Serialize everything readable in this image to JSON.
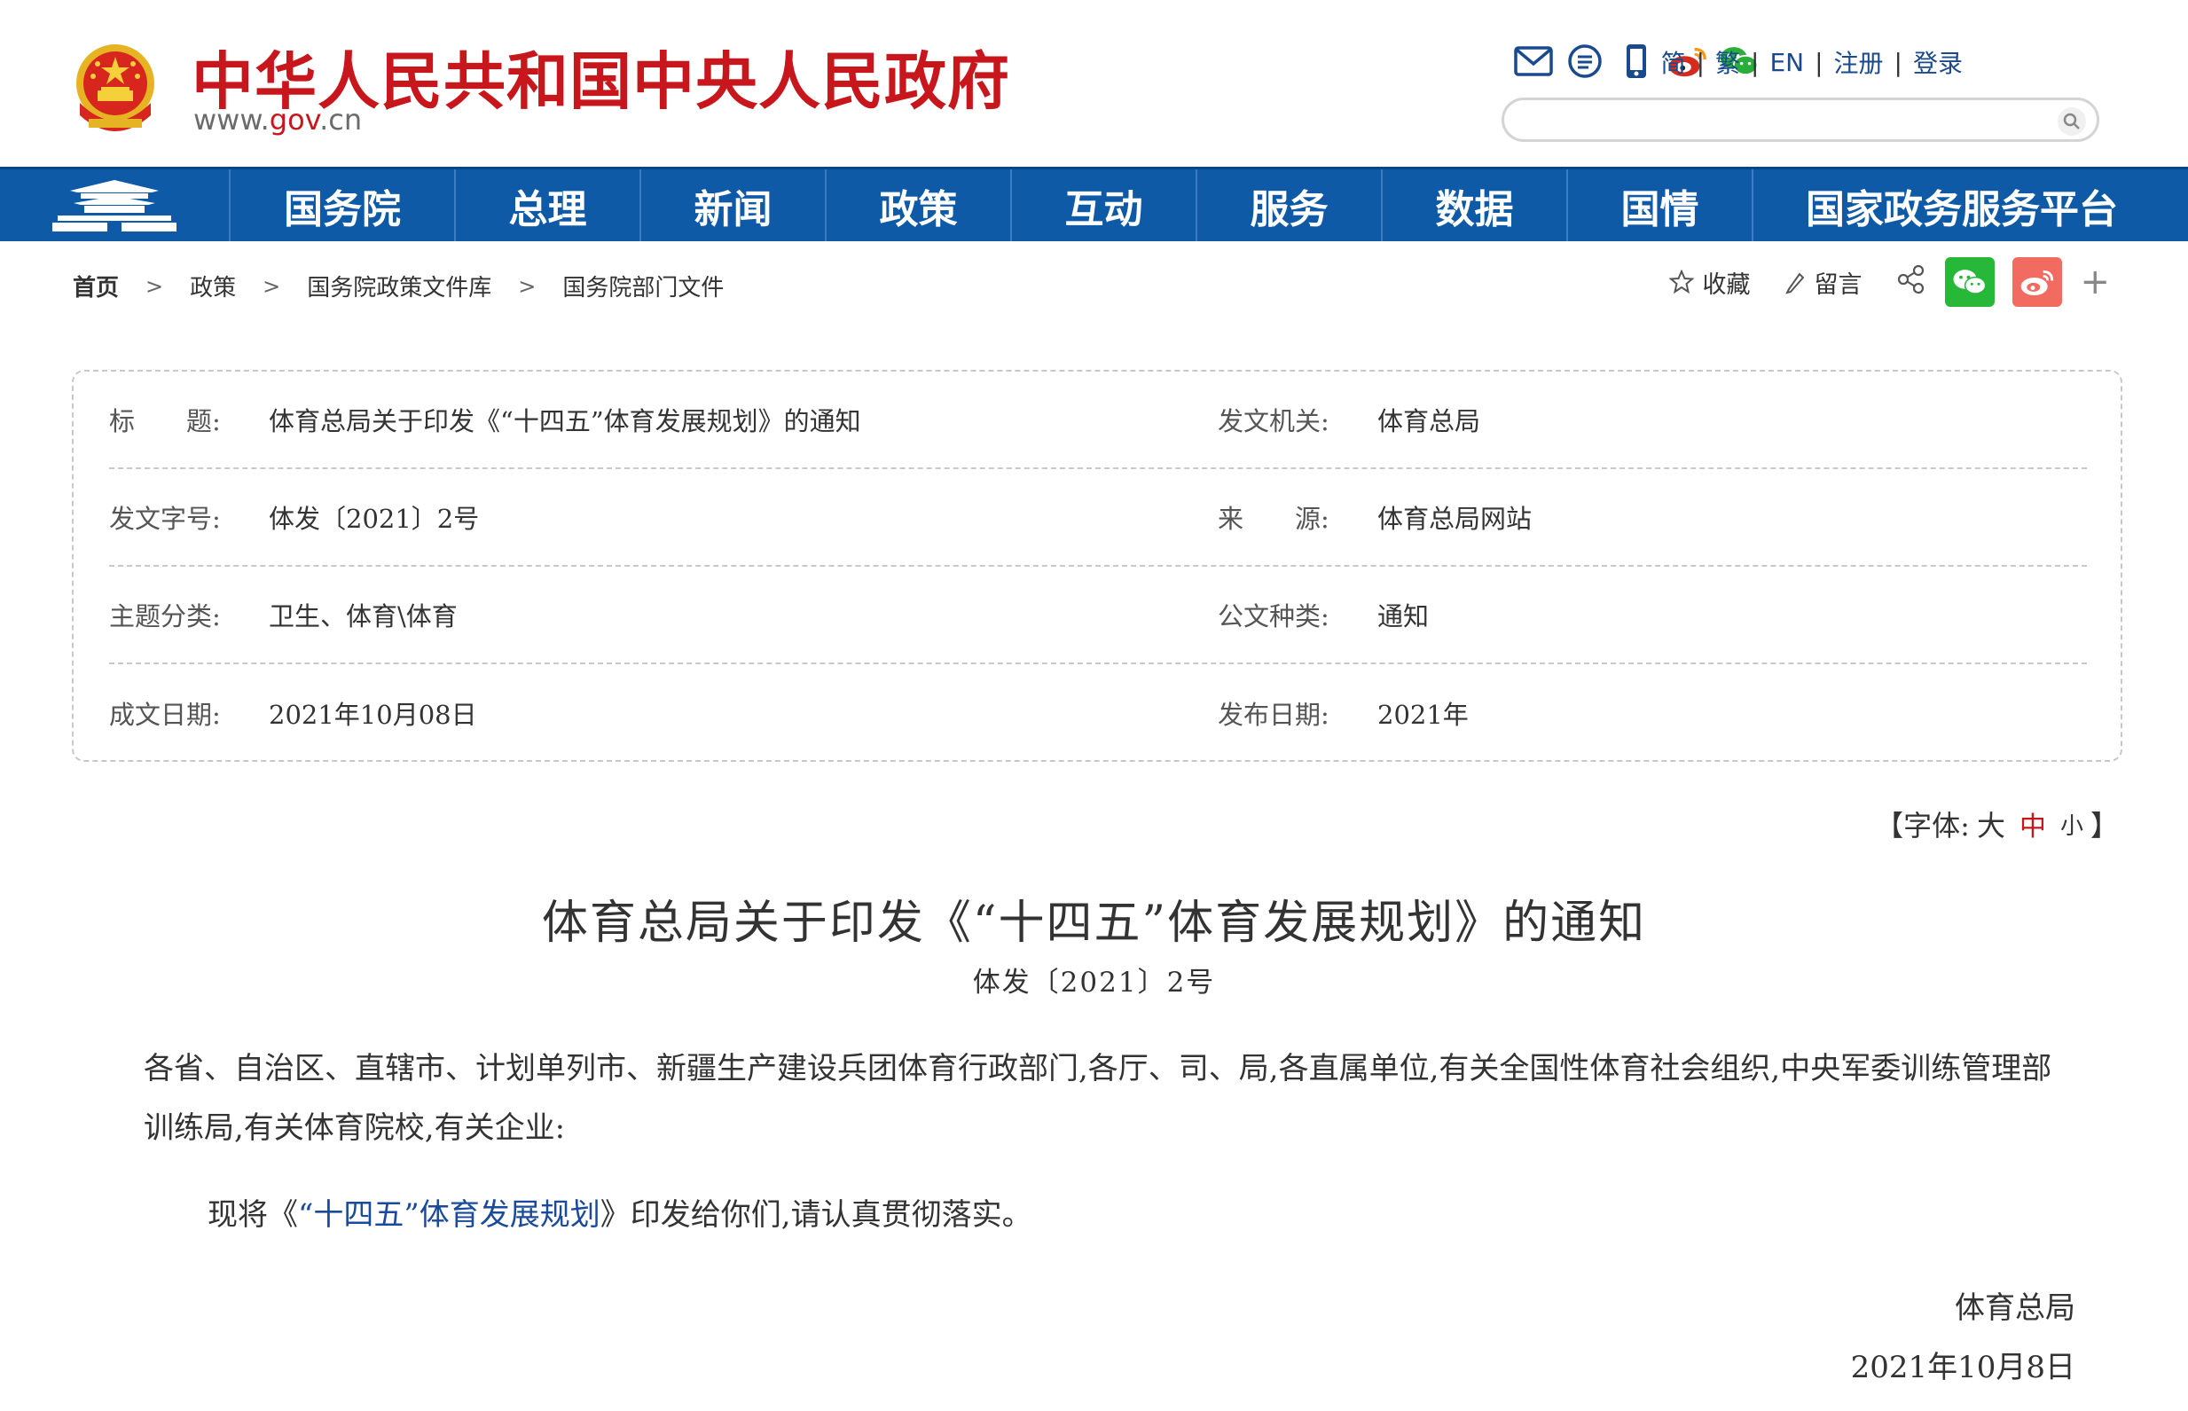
{
  "header": {
    "site_title": "中华人民共和国中央人民政府",
    "site_url_prefix": "www.",
    "site_url_gov": "gov",
    "site_url_suffix": ".cn",
    "icons": [
      "mail-icon",
      "message-icon",
      "mobile-icon",
      "weibo-icon",
      "wechat-icon"
    ],
    "links": [
      "简",
      "繁",
      "EN",
      "注册",
      "登录"
    ],
    "search": {
      "placeholder": "",
      "value": ""
    }
  },
  "nav": {
    "items": [
      "国务院",
      "总理",
      "新闻",
      "政策",
      "互动",
      "服务",
      "数据",
      "国情",
      "国家政务服务平台"
    ],
    "accent": "#0e5aa7"
  },
  "breadcrumb": [
    "首页",
    "政策",
    "国务院政策文件库",
    "国务院部门文件"
  ],
  "share": {
    "favorite": "收藏",
    "comment": "留言",
    "wechat_color": "#27b83a",
    "weibo_color": "#f26b61",
    "more": "+"
  },
  "info": {
    "rows": [
      {
        "l_label": "标　　题:",
        "l_value": "体育总局关于印发《“十四五”体育发展规划》的通知",
        "r_label": "发文机关:",
        "r_value": "体育总局"
      },
      {
        "l_label": "发文字号:",
        "l_value": "体发〔2021〕2号",
        "r_label": "来　　源:",
        "r_value": "体育总局网站"
      },
      {
        "l_label": "主题分类:",
        "l_value": "卫生、体育\\体育",
        "r_label": "公文种类:",
        "r_value": "通知"
      },
      {
        "l_label": "成文日期:",
        "l_value": "2021年10月08日",
        "r_label": "发布日期:",
        "r_value": "2021年"
      }
    ]
  },
  "font_size": {
    "open": "【字体:",
    "large": "大",
    "medium": "中",
    "small": "小",
    "close": "】"
  },
  "article": {
    "title": "体育总局关于印发《“十四五”体育发展规划》的通知",
    "doc_number": "体发〔2021〕2号",
    "recipients": "各省、自治区、直辖市、计划单列市、新疆生产建设兵团体育行政部门,各厅、司、局,各直属单位,有关全国性体育社会组织,中央军委训练管理部训练局,有关体育院校,有关企业:",
    "body_prefix": "现将《",
    "body_link": "“十四五”体育发展规划",
    "body_suffix": "》印发给你们,请认真贯彻落实。",
    "sign_org": "体育总局",
    "sign_date": "2021年10月8日"
  }
}
